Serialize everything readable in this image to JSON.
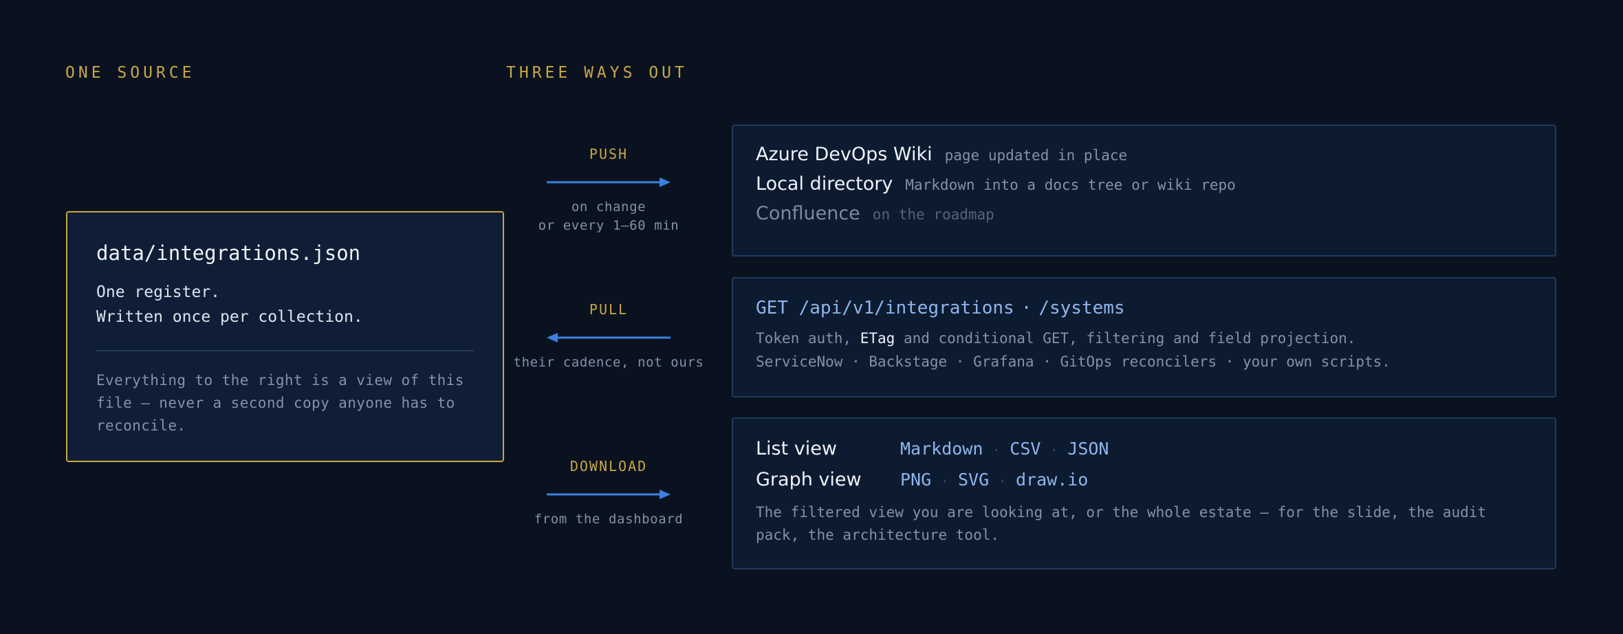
{
  "headings": {
    "source": "ONE SOURCE",
    "ways": "THREE WAYS OUT"
  },
  "source": {
    "file": "data/integrations.json",
    "line1": "One register.",
    "line2": "Written once per collection.",
    "note": "Everything to the right is a view of this file — never a second copy anyone has to reconcile."
  },
  "connectors": {
    "push": {
      "label": "PUSH",
      "sub1": "on change",
      "sub2": "or every 1–60 min",
      "direction": "right"
    },
    "pull": {
      "label": "PULL",
      "sub1": "their cadence, not ours",
      "direction": "left"
    },
    "download": {
      "label": "DOWNLOAD",
      "sub1": "from the dashboard",
      "direction": "right"
    }
  },
  "push_card": {
    "destinations": [
      {
        "name": "Azure DevOps Wiki",
        "desc": "page updated in place"
      },
      {
        "name": "Local directory",
        "desc": "Markdown into a docs tree or wiki repo"
      },
      {
        "name": "Confluence",
        "desc": "on the roadmap"
      }
    ]
  },
  "pull_card": {
    "endpoint_a": "GET /api/v1/integrations",
    "endpoint_sep": "·",
    "endpoint_b": "/systems",
    "desc1_pre": "Token auth, ",
    "desc1_code": "ETag",
    "desc1_post": " and conditional GET, filtering and field projection.",
    "desc2": "ServiceNow · Backstage · Grafana · GitOps reconcilers · your own scripts."
  },
  "download_card": {
    "list_label": "List view",
    "list_formats": [
      "Markdown",
      "CSV",
      "JSON"
    ],
    "graph_label": "Graph view",
    "graph_formats": [
      "PNG",
      "SVG",
      "draw.io"
    ],
    "format_sep": "·",
    "desc": "The filtered view you are looking at, or the whole estate — for the slide, the audit pack, the architecture tool."
  },
  "colors": {
    "accent": "#c9a745",
    "arrow": "#3b82e0",
    "link": "#8fb6ea",
    "background": "#0a1220"
  }
}
